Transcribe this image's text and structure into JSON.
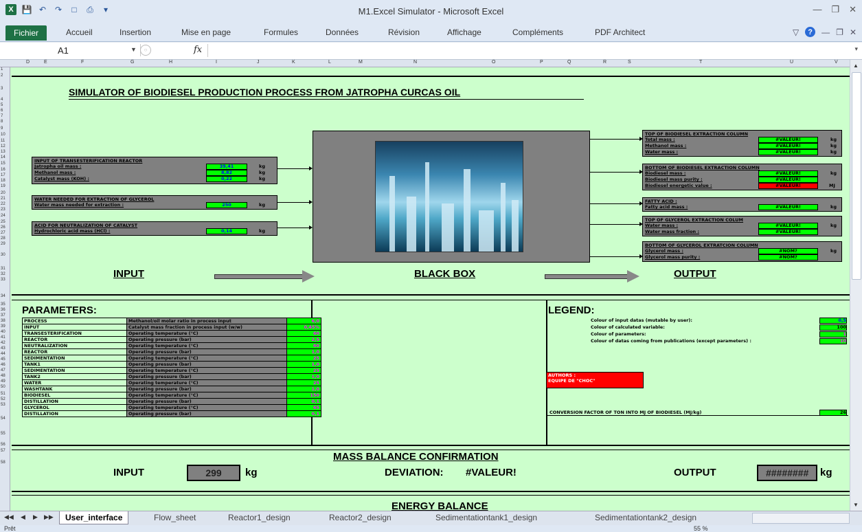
{
  "window": {
    "title": "M1.Excel Simulator  -  Microsoft Excel",
    "quick_access": [
      "excel-logo-icon",
      "save-icon",
      "undo-icon",
      "redo-icon",
      "new-icon",
      "print-preview-icon",
      "customize-icon"
    ],
    "controls": [
      "minimize",
      "restore",
      "close"
    ]
  },
  "ribbon": {
    "file": "Fichier",
    "tabs": [
      "Accueil",
      "Insertion",
      "Mise en page",
      "Formules",
      "Données",
      "Révision",
      "Affichage",
      "Compléments",
      "PDF Architect"
    ]
  },
  "formula_bar": {
    "cell_ref": "A1",
    "fx": "fx",
    "value": ""
  },
  "columns": [
    "D",
    "E",
    "F",
    "G",
    "H",
    "I",
    "J",
    "K",
    "L",
    "M",
    "N",
    "O",
    "P",
    "Q",
    "R",
    "S",
    "T",
    "U",
    "V"
  ],
  "sheet": {
    "title": "SIMULATOR OF BIODIESEL PRODUCTION PROCESS FROM JATROPHA CURCAS OIL",
    "inputs": [
      {
        "header": "INPUT OF TRANSESTERIFICATION REACTOR",
        "rows": [
          {
            "label": "Jatropha oil mass :",
            "value": "39,41",
            "unit": "kg"
          },
          {
            "label": "Methanol mass :",
            "value": "8,82",
            "unit": "kg"
          },
          {
            "label": "Catalyst mass (KOH) :",
            "value": "0,22",
            "unit": "kg"
          }
        ]
      },
      {
        "header": "WATER NEEDED FOR EXTRACTION OF GLYCEROL",
        "rows": [
          {
            "label": "Water mass needed for extraction :",
            "value": "250",
            "unit": "kg"
          }
        ]
      },
      {
        "header": "ACID FOR NEUTRALIZATION OF CATALYST",
        "rows": [
          {
            "label": "Hydrochloric acid mass (HCl) :",
            "value": "0,14",
            "unit": "kg"
          }
        ]
      }
    ],
    "outputs": [
      {
        "header": "TOP OF BIODIESEL EXTRACTION COLUMN",
        "rows": [
          {
            "label": "Total mass :",
            "value": "#VALEUR!",
            "unit": "kg",
            "red": false
          },
          {
            "label": "Methanol mass :",
            "value": "#VALEUR!",
            "unit": "kg",
            "red": false
          },
          {
            "label": "Water mass :",
            "value": "#VALEUR!",
            "unit": "kg",
            "red": false
          }
        ]
      },
      {
        "header": "BOTTOM OF BIODIESEL EXTRACTION COLUMN",
        "rows": [
          {
            "label": "Biodiesel mass :",
            "value": "#VALEUR!",
            "unit": "kg",
            "red": false
          },
          {
            "label": "Biodiesel mass purity :",
            "value": "#VALEUR!",
            "unit": "",
            "red": false
          },
          {
            "label": "Biodiesel energetic value :",
            "value": "#VALEUR!",
            "unit": "MJ",
            "red": true
          }
        ]
      },
      {
        "header": "FATTY ACID :",
        "rows": [
          {
            "label": "Fatty acid mass :",
            "value": "#VALEUR!",
            "unit": "kg",
            "red": false
          }
        ]
      },
      {
        "header": "TOP OF GLYCEROL EXTRACTION COLUM",
        "rows": [
          {
            "label": "Water mass :",
            "value": "#VALEUR!",
            "unit": "kg",
            "red": false
          },
          {
            "label": "Water mass fraction :",
            "value": "#VALEUR!",
            "unit": "",
            "red": false
          }
        ]
      },
      {
        "header": "BOTTOM OF GLYCEROL EXTRATCION COLUMN",
        "rows": [
          {
            "label": "Glycerol mass :",
            "value": "#NOM?",
            "unit": "kg",
            "red": false
          },
          {
            "label": "Glycerol mass purity :",
            "value": "#NOM?",
            "unit": "",
            "red": false
          }
        ]
      }
    ],
    "section_labels": {
      "input": "INPUT",
      "black_box": "BLACK BOX",
      "output": "OUTPUT"
    },
    "parameters_title": "PARAMETERS:",
    "parameters": [
      {
        "c1": "PROCESS",
        "c2": "Methanol/oil molar ratio in process input",
        "c3": "6,0"
      },
      {
        "c1": "INPUT",
        "c2": "Catalyst mass fraction in process input (w/w)",
        "c3": "0,45%"
      },
      {
        "c1": "TRANSESTERIFICATION",
        "c2": "Operating temperature (°C)",
        "c3": "60"
      },
      {
        "c1": "REACTOR",
        "c2": "Operating pressure (bar)",
        "c3": "2,5"
      },
      {
        "c1": "NEUTRALIZATION",
        "c2": "Operating temperature (°C)",
        "c3": "60"
      },
      {
        "c1": "REACTOR",
        "c2": "Operating pressure (bar)",
        "c3": "1,0"
      },
      {
        "c1": "SEDIMENTATION",
        "c2": "Operating temperature (°C)",
        "c3": "25"
      },
      {
        "c1": "TANK1",
        "c2": "Operating pressure (bar)",
        "c3": "1,0"
      },
      {
        "c1": "SEDIMENTATION",
        "c2": "Operating temperature (°C)",
        "c3": "25"
      },
      {
        "c1": "TANK2",
        "c2": "Operating pressure (bar)",
        "c3": "1,0"
      },
      {
        "c1": "WATER",
        "c2": "Operating temperature (°C)",
        "c3": "25"
      },
      {
        "c1": "WASHTANK",
        "c2": "Operating pressure (bar)",
        "c3": "1,0"
      },
      {
        "c1": "BIODIESEL",
        "c2": "Operating temperature (°C)",
        "c3": "150"
      },
      {
        "c1": "DISTILLATION",
        "c2": "Operating pressure (bar)",
        "c3": "0,1"
      },
      {
        "c1": "GLYCEROL",
        "c2": "Operating temperature (°C)",
        "c3": "65"
      },
      {
        "c1": "DISTILLATION",
        "c2": "Operating pressure (bar)",
        "c3": "0,1"
      }
    ],
    "legend_title": "LEGEND:",
    "legend": [
      {
        "label": "Colour of input datas (mutable by user):",
        "value": "0,5"
      },
      {
        "label": "Colour of calculated variable:",
        "value": "100"
      },
      {
        "label": "Colour of parameters:",
        "value": "1"
      },
      {
        "label": "Colour of datas coming from publications (except parameters) :",
        "value": "10"
      }
    ],
    "authors": {
      "line1": "AUTHORS :",
      "line2": "EQUIPE DE \"CHOC\""
    },
    "conversion": {
      "label": "CONVERSION FACTOR OF TON INTO MJ OF BIODIESEL (MJ/kg)",
      "value": "26"
    },
    "mass_balance": {
      "title": "MASS BALANCE CONFIRMATION",
      "input_label": "INPUT",
      "input_value": "299",
      "input_unit": "kg",
      "deviation_label": "DEVIATION:",
      "deviation_value": "#VALEUR!",
      "output_label": "OUTPUT",
      "output_value": "########",
      "output_unit": "kg"
    },
    "energy_title": "ENERGY BALANCE"
  },
  "row_numbers": [
    "1",
    "2",
    "3",
    "4",
    "5",
    "6",
    "7",
    "8",
    "9",
    "10",
    "11",
    "12",
    "13",
    "14",
    "15",
    "16",
    "17",
    "18",
    "19",
    "20",
    "21",
    "22",
    "23",
    "24",
    "25",
    "26",
    "27",
    "28",
    "29",
    "30",
    "31",
    "32",
    "33",
    "34",
    "35",
    "36",
    "37",
    "38",
    "39",
    "40",
    "41",
    "42",
    "43",
    "44",
    "45",
    "46",
    "47",
    "48",
    "49",
    "50",
    "51",
    "52",
    "53",
    "54",
    "55",
    "56",
    "57",
    "58"
  ],
  "sheet_tabs": [
    "User_interface",
    "Flow_sheet",
    "Reactor1_design",
    "Reactor2_design",
    "Sedimentationtank1_design",
    "Sedimentationtank2_design"
  ],
  "status": {
    "ready": "Prêt",
    "zoom": "55 %"
  }
}
